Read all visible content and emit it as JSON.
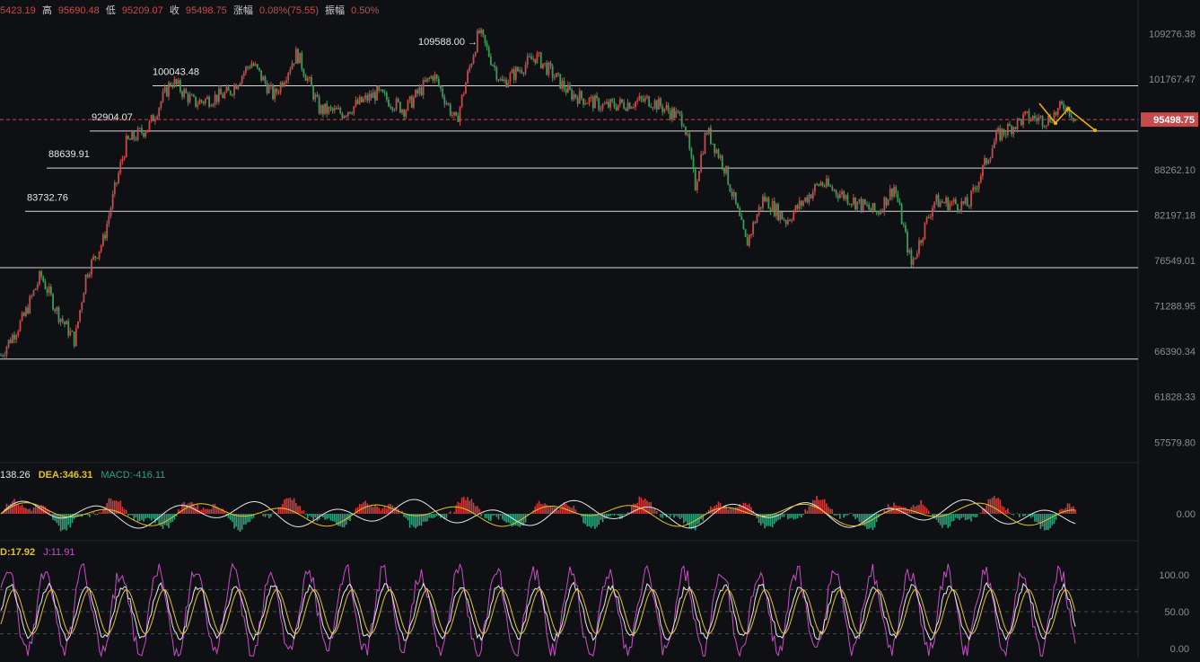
{
  "header": {
    "open_value": "5423.19",
    "high_label": "高",
    "high_value": "95690.48",
    "low_label": "低",
    "low_value": "95209.07",
    "close_label": "收",
    "close_value": "95498.75",
    "change_label": "涨幅",
    "change_value": "0.08%(75.55)",
    "amplitude_label": "振幅",
    "amplitude_value": "0.50%"
  },
  "macd_header": {
    "dif": "138.26",
    "dea": "DEA:346.31",
    "macd": "MACD:-416.11"
  },
  "kdj_header": {
    "d": "D:17.92",
    "j": "J:11.91"
  },
  "colors": {
    "background": "#0f1013",
    "up": "#c94a4a",
    "down": "#3d9a5a",
    "macd_hist_up": "#d13a3a",
    "macd_hist_down": "#2aa37a",
    "dif_line": "#e8e8e8",
    "dea_line": "#e6c229",
    "kdj_k": "#e8e8e8",
    "kdj_d": "#e6c229",
    "kdj_j": "#c84ec8",
    "price_tag": "#c94a4a",
    "arrow": "#f0b400"
  },
  "chart_data": {
    "type": "candlestick",
    "y_axis_ticks": [
      "109276.38",
      "101767.47",
      "95498.75",
      "88262.10",
      "82197.18",
      "76549.01",
      "71288.95",
      "66390.34",
      "61828.33",
      "57579.80"
    ],
    "current_price": "95498.75",
    "level_labels": [
      {
        "price": "109588.00"
      },
      {
        "price": "100043.48"
      },
      {
        "price": "92904.07"
      },
      {
        "price": "88639.91"
      },
      {
        "price": "83732.76"
      }
    ],
    "horizontal_levels": [
      100700,
      93800,
      88500,
      82700,
      75700,
      65600
    ],
    "ylim": [
      56000,
      112000
    ],
    "trend": [
      [
        0,
        66000
      ],
      [
        0.02,
        70000
      ],
      [
        0.035,
        74800
      ],
      [
        0.05,
        70500
      ],
      [
        0.065,
        67500
      ],
      [
        0.075,
        75000
      ],
      [
        0.09,
        79000
      ],
      [
        0.1,
        85500
      ],
      [
        0.11,
        92000
      ],
      [
        0.13,
        94500
      ],
      [
        0.15,
        101500
      ],
      [
        0.17,
        98000
      ],
      [
        0.2,
        99500
      ],
      [
        0.22,
        104500
      ],
      [
        0.24,
        99000
      ],
      [
        0.26,
        106000
      ],
      [
        0.28,
        97000
      ],
      [
        0.3,
        96500
      ],
      [
        0.33,
        99500
      ],
      [
        0.355,
        97000
      ],
      [
        0.38,
        102500
      ],
      [
        0.4,
        95000
      ],
      [
        0.42,
        109588
      ],
      [
        0.44,
        101000
      ],
      [
        0.47,
        105500
      ],
      [
        0.5,
        99500
      ],
      [
        0.53,
        97500
      ],
      [
        0.57,
        98500
      ],
      [
        0.6,
        95500
      ],
      [
        0.61,
        86000
      ],
      [
        0.62,
        94000
      ],
      [
        0.635,
        89000
      ],
      [
        0.655,
        78500
      ],
      [
        0.67,
        84500
      ],
      [
        0.69,
        81500
      ],
      [
        0.72,
        86500
      ],
      [
        0.75,
        84000
      ],
      [
        0.77,
        82500
      ],
      [
        0.785,
        86000
      ],
      [
        0.8,
        76000
      ],
      [
        0.82,
        84000
      ],
      [
        0.85,
        83500
      ],
      [
        0.875,
        93000
      ],
      [
        0.9,
        95800
      ],
      [
        0.92,
        95500
      ],
      [
        0.935,
        97800
      ],
      [
        0.945,
        95500
      ]
    ],
    "macd": {
      "zero_label": "0.00"
    },
    "kdj": {
      "levels": [
        "100.00",
        "50.00",
        "0.00"
      ]
    },
    "forecast_arrows": "yellow zig-zag arrows after last candle"
  }
}
